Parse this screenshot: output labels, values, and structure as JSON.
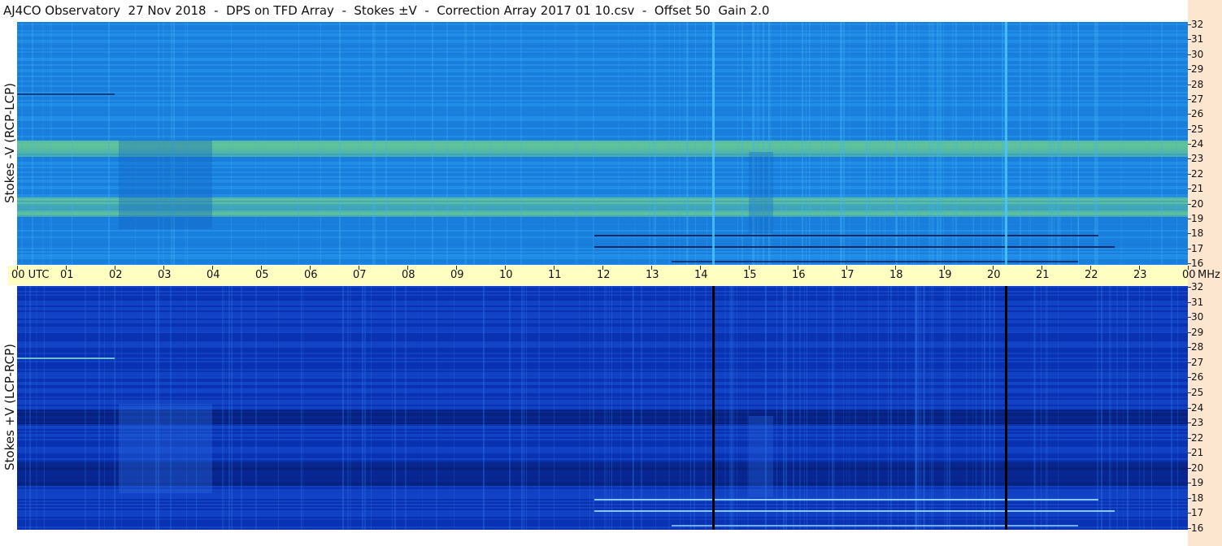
{
  "title": "AJ4CO Observatory  27 Nov 2018  -  DPS on TFD Array  -  Stokes ±V  -  Correction Array 2017 01 10.csv  -  Offset 50  Gain 2.0",
  "panels": {
    "top": {
      "ylabel": "Stokes -V (RCP-LCP)"
    },
    "bottom": {
      "ylabel": "Stokes +V (LCP-RCP)"
    }
  },
  "freq_labels": [
    "32",
    "31",
    "30",
    "29",
    "28",
    "27",
    "26",
    "25",
    "24",
    "23",
    "22",
    "21",
    "20",
    "19",
    "18",
    "17",
    "16"
  ],
  "time_labels": [
    "00 UTC",
    "01",
    "02",
    "03",
    "04",
    "05",
    "06",
    "07",
    "08",
    "09",
    "10",
    "11",
    "12",
    "13",
    "14",
    "15",
    "16",
    "17",
    "18",
    "19",
    "20",
    "21",
    "22",
    "23",
    "00"
  ],
  "freq_unit": "MHz",
  "colors": {
    "top_base": "#1b83e0",
    "top_bright": "#7fe07a",
    "bottom_base": "#0a34b8",
    "bottom_dark": "#061a6a",
    "axis_bg": "#ffffc2",
    "right_strip": "#fde6cf"
  }
}
